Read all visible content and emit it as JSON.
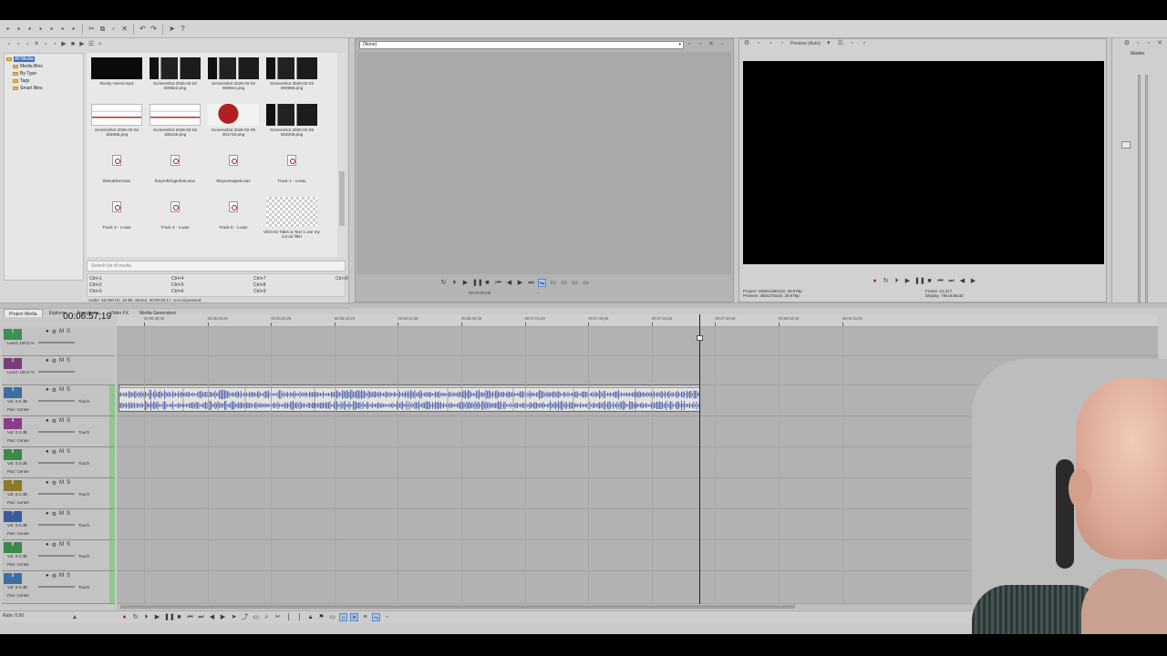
{
  "media": {
    "tree": [
      "All Media",
      "Media Bins",
      "By Type",
      "Tags",
      "Smart Bins"
    ],
    "items": [
      {
        "name": "Rocky Horror.mp4",
        "kind": "dark"
      },
      {
        "name": "Screenshot 2026-02-02 000922.png",
        "kind": "shot"
      },
      {
        "name": "Screenshot 2026-02-02 000944.png",
        "kind": "shot"
      },
      {
        "name": "Screenshot 2026-02-02 000958.png",
        "kind": "shot"
      },
      {
        "name": "Screenshot 2026-02-02 184858.png",
        "kind": "web"
      },
      {
        "name": "Screenshot 2026-02-02 185159.png",
        "kind": "web"
      },
      {
        "name": "Screenshot 2026-02-05 001743.png",
        "kind": "red"
      },
      {
        "name": "Screenshot 2026-02-05 004008.png",
        "kind": "shot"
      },
      {
        "name": "thesubtext.wav",
        "kind": "audio"
      },
      {
        "name": "theyrebringedout.wav",
        "kind": "audio"
      },
      {
        "name": "theyvereaped.wav",
        "kind": "audio"
      },
      {
        "name": "Track 1 - 1.wav",
        "kind": "audio"
      },
      {
        "name": "Track 3 - 1.wav",
        "kind": "audio"
      },
      {
        "name": "Track 4 - 1.wav",
        "kind": "audio"
      },
      {
        "name": "Track 6 - 1.wav",
        "kind": "audio"
      },
      {
        "name": "VEGAS Titles & Text 1 use my cut as filter",
        "kind": "checker"
      }
    ],
    "filter_placeholder": "Search list of media",
    "shortcuts": [
      "Ctrl+1",
      "Ctrl+4",
      "Ctrl+7",
      "Ctrl+2",
      "Ctrl+5",
      "Ctrl+8",
      "Ctrl+3",
      "Ctrl+6",
      "Ctrl+9",
      "Ctrl+0"
    ],
    "status": "Audio: 48,000 Hz, 16 Bit, Stereo, 00:00:20;17, Uncompressed",
    "tabs": [
      "Project Media",
      "Explorer",
      "Transitions",
      "Video FX",
      "Media Generators"
    ]
  },
  "trimmer": {
    "source": "(None)",
    "time_in": "00:00:00;00",
    "time_out": "--"
  },
  "preview": {
    "mode": "Preview (Auto)",
    "project": "Project: 1920x1080x32, 29.970p",
    "preview": "Preview: 480x270x32, 29.970p",
    "frame": "Frame: 12,217",
    "display": "Display: 791x445x32"
  },
  "master": {
    "label": "Master"
  },
  "timeline": {
    "timecode": "00:06:57;19",
    "ruler": [
      "00:05:35;00",
      "00:05:49;29",
      "00:06:04;29",
      "00:06:19;29",
      "00:06:34;29",
      "00:06:49;29",
      "00:07:04;29",
      "00:07:19;29",
      "00:07:34;29",
      "00:07:49;29",
      "00:08:04;29",
      "00:08:19;29"
    ],
    "tracks": [
      {
        "num": "1",
        "type": "video",
        "color": "#3f8f5a",
        "level": "Level: 100.0 %"
      },
      {
        "num": "2",
        "type": "video",
        "color": "#7a3b7a",
        "level": "Level: 100.0 %"
      },
      {
        "num": "3",
        "type": "audio",
        "color": "#3a6fa0",
        "vol": "Vol: 0.0 dB",
        "pan": "Pan: Center",
        "mode": "Touch"
      },
      {
        "num": "4",
        "type": "audio",
        "color": "#8a3b8a",
        "vol": "Vol: 0.0 dB",
        "pan": "Pan: Center",
        "mode": "Touch"
      },
      {
        "num": "5",
        "type": "audio",
        "color": "#3a8a4a",
        "vol": "Vol: 0.0 dB",
        "pan": "Pan: Center",
        "mode": "Touch"
      },
      {
        "num": "6",
        "type": "audio",
        "color": "#8a7a2a",
        "vol": "Vol: 0.0 dB",
        "pan": "Pan: Center",
        "mode": "Touch"
      },
      {
        "num": "7",
        "type": "audio",
        "color": "#3a5a9a",
        "vol": "Vol: 0.0 dB",
        "pan": "Pan: Center",
        "mode": "Touch"
      },
      {
        "num": "8",
        "type": "audio",
        "color": "#3a8a4a",
        "vol": "Vol: 0.0 dB",
        "pan": "Pan: Center",
        "mode": "Touch"
      },
      {
        "num": "9",
        "type": "audio",
        "color": "#3a6fa0",
        "vol": "Vol: 0.0 dB",
        "pan": "Pan: Center",
        "mode": "Touch"
      }
    ],
    "rate": "Rate: 0.00"
  }
}
